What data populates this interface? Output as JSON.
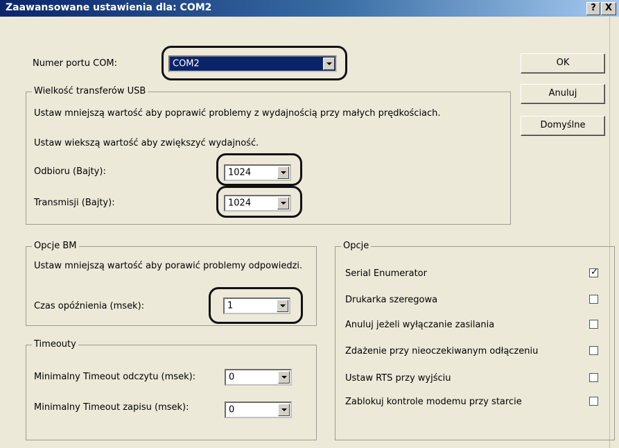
{
  "window": {
    "title": "Zaawansowane ustawienia dla: COM2",
    "help_button": "?",
    "close_button": "X"
  },
  "com_port": {
    "label": "Numer portu COM:",
    "value": "COM2"
  },
  "buttons": {
    "ok": "OK",
    "cancel": "Anuluj",
    "defaults": "Domyślne"
  },
  "usb_transfer": {
    "legend": "Wielkość transferów USB",
    "desc1": "Ustaw mniejszą wartość aby poprawić problemy z wydajnością przy małych prędkościach.",
    "desc2": "Ustaw wiekszą wartość aby zwiększyć wydajność.",
    "receive_label": "Odbioru (Bajty):",
    "receive_value": "1024",
    "transmit_label": "Transmisji (Bajty):",
    "transmit_value": "1024"
  },
  "bm_options": {
    "legend": "Opcje BM",
    "desc": "Ustaw mniejszą wartość aby porawić problemy odpowiedzi.",
    "latency_label": "Czas opóźnienia (msek):",
    "latency_value": "1"
  },
  "timeouts": {
    "legend": "Timeouty",
    "read_label": "Minimalny Timeout odczytu (msek):",
    "read_value": "0",
    "write_label": "Minimalny Timeout zapisu (msek):",
    "write_value": "0"
  },
  "options": {
    "legend": "Opcje",
    "items": [
      {
        "label": "Serial Enumerator",
        "checked": true
      },
      {
        "label": "Drukarka szeregowa",
        "checked": false
      },
      {
        "label": "Anuluj jeżeli wyłączanie zasilania",
        "checked": false
      },
      {
        "label": "Zdażenie przy nieoczekiwanym odłączeniu",
        "checked": false
      },
      {
        "label": "Ustaw RTS przy wyjściu",
        "checked": false
      },
      {
        "label": "Zablokuj kontrole modemu przy starcie",
        "checked": false
      }
    ]
  }
}
